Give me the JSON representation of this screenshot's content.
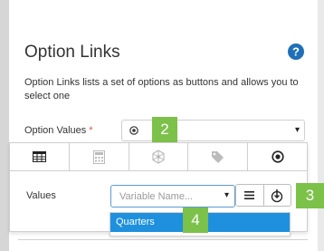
{
  "panel": {
    "title": "Option Links",
    "description": "Option Links lists a set of options as buttons and allows you to select one",
    "help_icon": "question-circle-icon",
    "accent_color": "#1e6fb8"
  },
  "option_values": {
    "label": "Option Values",
    "required_mark": "*",
    "selected_icon": "radio-target-icon",
    "caret": "▾"
  },
  "tabs": [
    {
      "icon": "table-icon",
      "active": true
    },
    {
      "icon": "calculator-icon",
      "active": false
    },
    {
      "icon": "hexagon-network-icon",
      "active": false
    },
    {
      "icon": "tag-icon",
      "active": false
    },
    {
      "icon": "radio-target-icon",
      "active": true
    }
  ],
  "values_row": {
    "label": "Values",
    "placeholder": "Variable Name...",
    "caret": "▾",
    "list_button_icon": "list-icon",
    "download_button_icon": "download-circle-icon"
  },
  "dropdown": {
    "items": [
      {
        "label": "Quarters",
        "highlighted": true
      }
    ],
    "highlight_color": "#1e90dd"
  },
  "badges": {
    "b2": "2",
    "b3": "3",
    "b4": "4",
    "color": "#7cc149"
  }
}
